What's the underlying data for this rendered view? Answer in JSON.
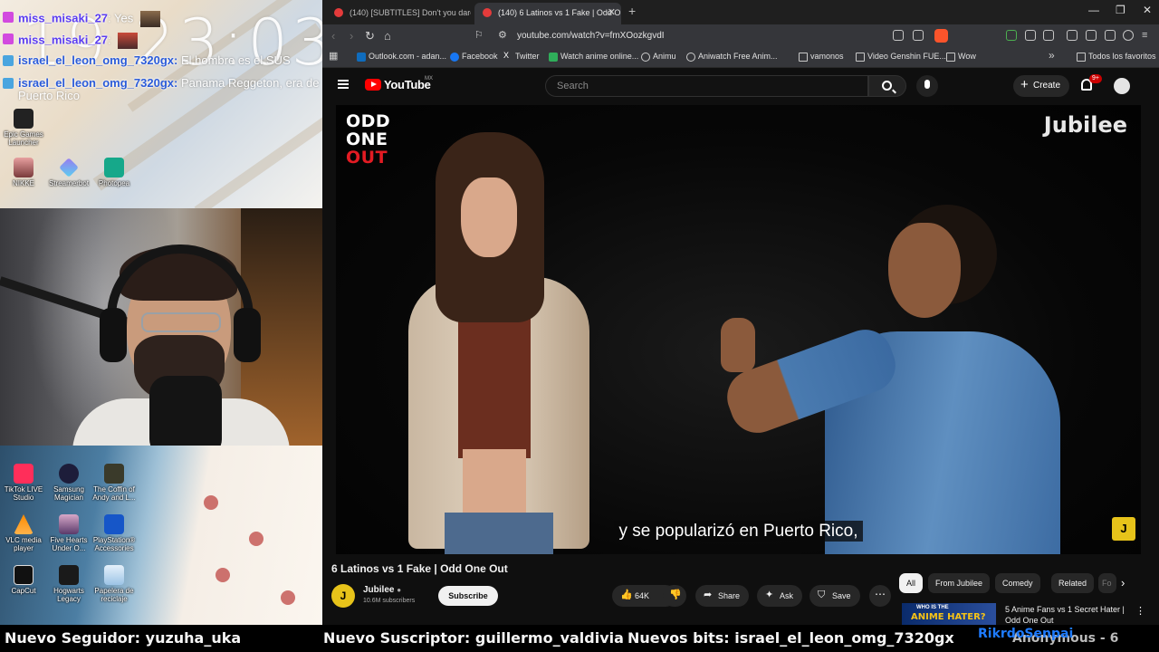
{
  "overlay": {
    "clock": "19:23:03",
    "chat": [
      {
        "user": "miss_misaki_27",
        "message": "Yes"
      },
      {
        "user": "miss_misaki_27",
        "message": ""
      },
      {
        "user": "israel_el_leon_omg_7320gx:",
        "message": "El hombre es el SUS"
      },
      {
        "user": "israel_el_leon_omg_7320gx:",
        "message": "Panama Reggeton, era de Puerto Rico"
      }
    ],
    "desktop_icons_top": [
      {
        "label": "Epic Games Launcher"
      },
      {
        "label": "NIKKE"
      },
      {
        "label": "Streamerbot"
      },
      {
        "label": "Photopea"
      }
    ],
    "desktop_icons_bottom": [
      {
        "label": "TikTok LIVE Studio"
      },
      {
        "label": "Samsung Magician"
      },
      {
        "label": "The Coffin of Andy and L..."
      },
      {
        "label": "VLC media player"
      },
      {
        "label": "Five Hearts Under O..."
      },
      {
        "label": "PlayStation® Accessories"
      },
      {
        "label": "CapCut"
      },
      {
        "label": "Hogwarts Legacy"
      },
      {
        "label": "Papelera de reciclaje"
      }
    ],
    "ticker": {
      "follower": "Nuevo Seguidor: yuzuha_uka",
      "subscriber": "Nuevo Suscriptor: guillermo_valdivia",
      "bits": "Nuevos bits: israel_el_leon_omg_7320gx",
      "extra": "Anonymous - 6",
      "blue_name": "RikrdoSenpai"
    }
  },
  "browser": {
    "tabs": [
      {
        "title": "(140) [SUBTITLES] Don't you dare for",
        "active": false
      },
      {
        "title": "(140) 6 Latinos vs 1 Fake | Odd O",
        "active": true
      }
    ],
    "url": "youtube.com/watch?v=fmXOozkgvdI",
    "bookmarks": [
      {
        "label": "Outlook.com - adan...",
        "icon": "outlook-icon"
      },
      {
        "label": "Facebook",
        "icon": "facebook-icon"
      },
      {
        "label": "Twitter",
        "icon": "x-icon"
      },
      {
        "label": "Watch anime online...",
        "icon": "anime-icon"
      },
      {
        "label": "Animu",
        "icon": "globe-icon"
      },
      {
        "label": "Aniwatch Free Anim...",
        "icon": "aniwatch-icon"
      },
      {
        "label": "vamonos",
        "icon": "folder-icon"
      },
      {
        "label": "Video Genshin FUE...",
        "icon": "folder-icon"
      },
      {
        "label": "Wow",
        "icon": "folder-icon"
      }
    ],
    "bookmarks_all": "Todos los favoritos"
  },
  "youtube": {
    "brand": "YouTube",
    "country": "MX",
    "search_placeholder": "Search",
    "create_label": "Create",
    "notif_count": "9+",
    "video": {
      "overlay_logo_lines": [
        "ODD",
        "ONE",
        "OUT"
      ],
      "watermark": "Jubilee",
      "subtitle": "y se popularizó en Puerto Rico,",
      "corner_logo": "J"
    },
    "title": "6 Latinos vs 1 Fake | Odd One Out",
    "channel": {
      "name": "Jubilee",
      "subscribers": "10.6M subscribers",
      "avatar_letter": "J"
    },
    "subscribe_label": "Subscribe",
    "actions": {
      "likes": "64K",
      "share": "Share",
      "ask": "Ask",
      "save": "Save"
    },
    "chips": [
      "All",
      "From Jubilee",
      "Comedy",
      "Related",
      "Fo"
    ],
    "recommended": {
      "title": "5 Anime Fans vs 1 Secret Hater | Odd One Out",
      "thumb_top": "WHO IS THE",
      "thumb_big": "ANIME HATER?"
    }
  }
}
